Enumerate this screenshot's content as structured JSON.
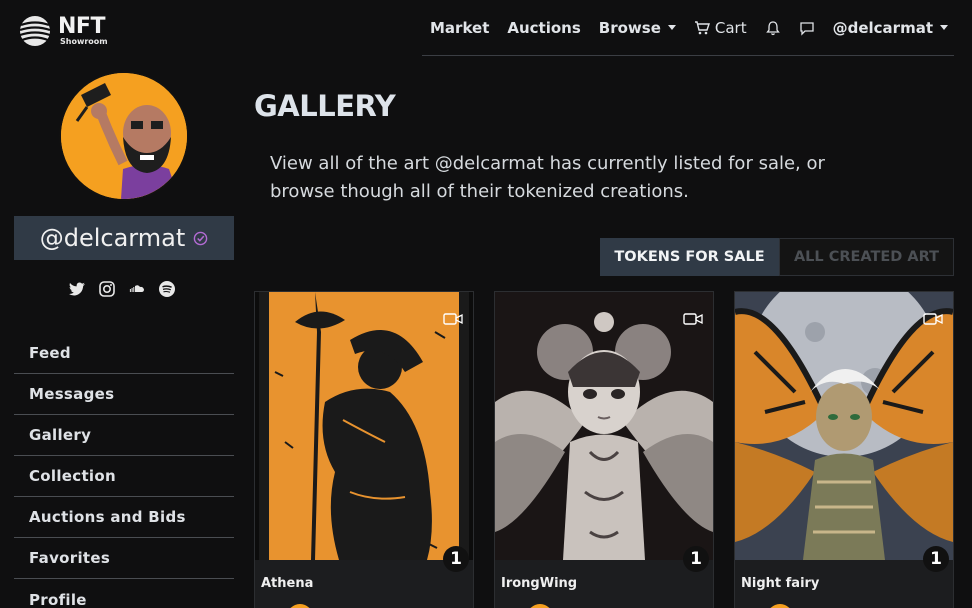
{
  "brand": {
    "name": "NFT",
    "tagline": "Showroom",
    "logo_icon": "striped-globe-logo"
  },
  "nav": {
    "market": "Market",
    "auctions": "Auctions",
    "browse": "Browse",
    "cart": "Cart",
    "user": "@delcarmat",
    "icons": [
      "cart-icon",
      "bell-icon",
      "chat-icon"
    ]
  },
  "profile": {
    "handle": "@delcarmat",
    "verified_icon": "verified-check-icon",
    "socials": [
      "twitter-icon",
      "instagram-icon",
      "soundcloud-icon",
      "spotify-icon"
    ]
  },
  "sidebar": {
    "items": [
      {
        "label": "Feed"
      },
      {
        "label": "Messages"
      },
      {
        "label": "Gallery"
      },
      {
        "label": "Collection"
      },
      {
        "label": "Auctions and Bids"
      },
      {
        "label": "Favorites"
      },
      {
        "label": "Profile"
      }
    ]
  },
  "main": {
    "title": "GALLERY",
    "intro_line1": "View all of the art @delcarmat has currently listed for sale, or",
    "intro_line2": "browse though all of their tokenized creations.",
    "tabs": [
      {
        "label": "TOKENS FOR SALE",
        "active": true
      },
      {
        "label": "ALL CREATED ART",
        "active": false
      }
    ]
  },
  "cards": [
    {
      "title": "Athena",
      "edition": "1",
      "media_icon": "video-icon"
    },
    {
      "title": "IrongWing",
      "edition": "1",
      "media_icon": "video-icon"
    },
    {
      "title": "Night fairy",
      "edition": "1",
      "media_icon": "video-icon"
    }
  ],
  "colors": {
    "background": "#0f0f10",
    "panel": "#303a46",
    "accent_orange": "#f5a020",
    "verified_purple": "#b36bd4"
  }
}
